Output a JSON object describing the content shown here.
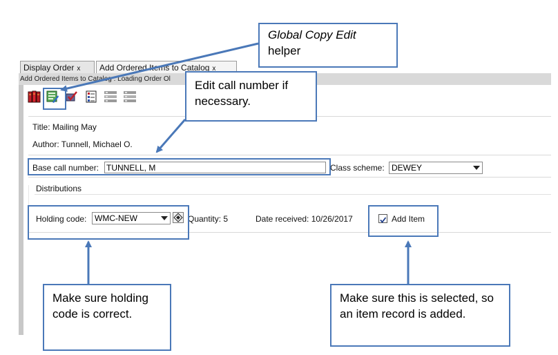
{
  "tabs": [
    {
      "label": "Display Order",
      "close": "x"
    },
    {
      "label": "Add Ordered Items to Catalog",
      "close": "x"
    }
  ],
  "status": "Add Ordered Items to Catalog : Loading Order  Ol",
  "toolbar": {
    "icons": [
      "catalog-books-icon",
      "global-copy-edit-icon",
      "edit-check-icon",
      "checklist-icon",
      "list-dim-icon",
      "list-dim-2-icon"
    ]
  },
  "record": {
    "title": "Title: Mailing May",
    "author": "Author: Tunnell, Michael O."
  },
  "call": {
    "label": "Base call number:",
    "value": "TUNNELL, M",
    "scheme_label": "Class scheme:",
    "scheme_value": "DEWEY"
  },
  "distributions": {
    "heading": "Distributions",
    "holding_label": "Holding code:",
    "holding_value": "WMC-NEW",
    "quantity": "Quantity: 5",
    "date_received": "Date received: 10/26/2017",
    "add_item_label": "Add Item",
    "add_item_checked": true
  },
  "callouts": {
    "global_copy_edit": "Global Copy Edit",
    "global_copy_edit_2": "helper",
    "edit_call_number": "Edit call number if necessary.",
    "holding_code": "Make sure holding code is correct.",
    "add_item": "Make sure this is selected, so an item record is added."
  },
  "colors": {
    "callout_border": "#4a78b8",
    "arrow": "#4a78b8"
  }
}
